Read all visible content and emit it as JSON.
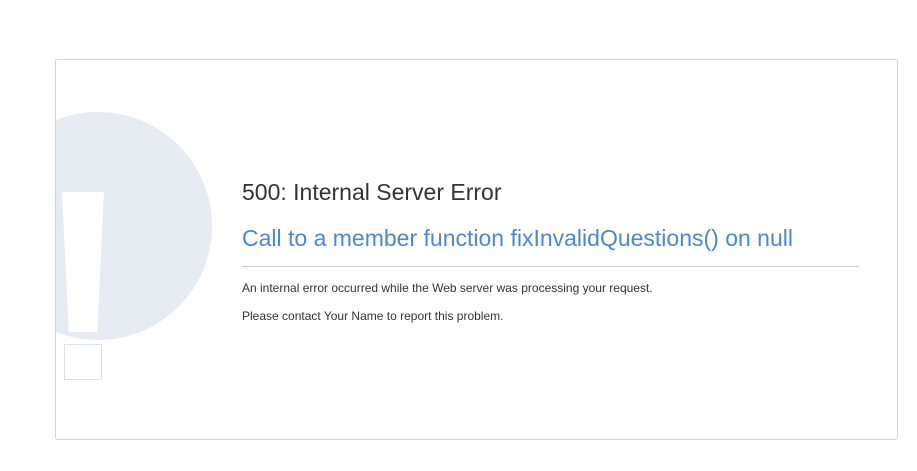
{
  "icon": {
    "name": "exclamation-icon",
    "circle_color": "#e5ebf0"
  },
  "error": {
    "title": "500: Internal Server Error",
    "message": "Call to a member function fixInvalidQuestions() on null",
    "message_color": "#4a88d0",
    "description": "An internal error occurred while the Web server was processing your request.",
    "contact": "Please contact Your Name to report this problem."
  }
}
